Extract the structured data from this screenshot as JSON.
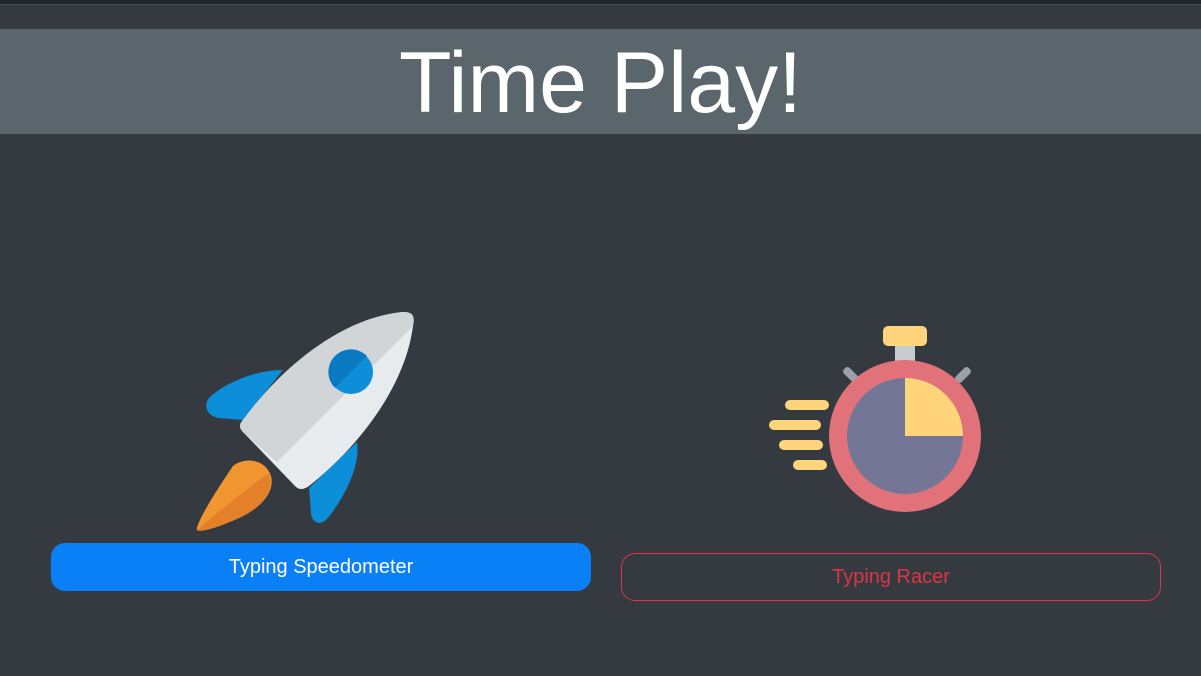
{
  "header": {
    "title": "Time Play!"
  },
  "games": [
    {
      "icon": "rocket-icon",
      "button_label": "Typing Speedometer",
      "button_style": "primary",
      "button_color": "#0a80f7"
    },
    {
      "icon": "stopwatch-icon",
      "button_label": "Typing Racer",
      "button_style": "outline-danger",
      "button_color": "#dc3545"
    }
  ],
  "colors": {
    "background": "#343a40",
    "banner": "#5a666c",
    "title_text": "#ffffff"
  }
}
